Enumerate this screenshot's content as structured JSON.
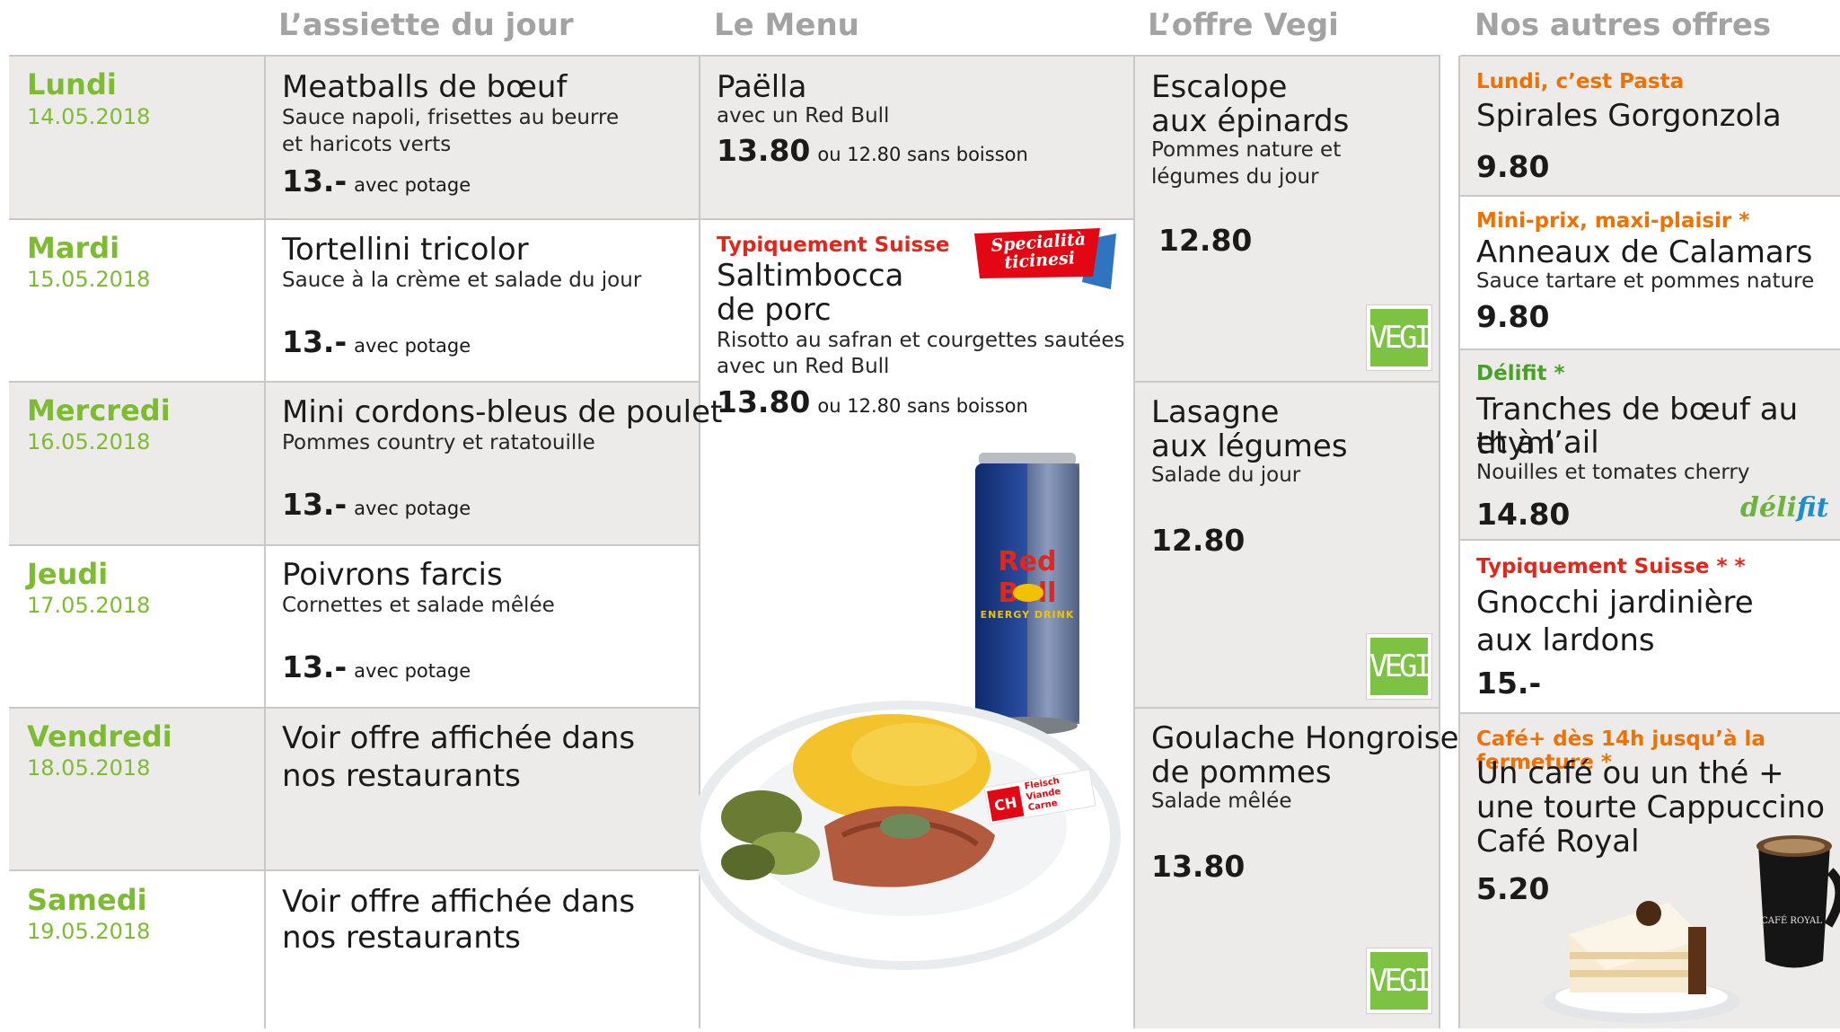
{
  "headers": {
    "assiette": "L’assiette du jour",
    "menu": "Le Menu",
    "vegi": "L’offre Vegi",
    "autres": "Nos autres offres"
  },
  "days": [
    {
      "name": "Lundi",
      "date": "14.05.2018",
      "title_lines": [
        "Meatballs de bœuf"
      ],
      "desc_lines": [
        "Sauce napoli, frisettes au beurre",
        "et haricots verts"
      ],
      "price": "13.-",
      "price_suffix": "avec potage"
    },
    {
      "name": "Mardi",
      "date": "15.05.2018",
      "title_lines": [
        "Tortellini tricolor"
      ],
      "desc_lines": [
        "Sauce à la crème et salade du jour"
      ],
      "price": "13.-",
      "price_suffix": "avec potage"
    },
    {
      "name": "Mercredi",
      "date": "16.05.2018",
      "title_lines": [
        "Mini cordons-bleus de poulet"
      ],
      "desc_lines": [
        "Pommes country et ratatouille"
      ],
      "price": "13.-",
      "price_suffix": "avec potage"
    },
    {
      "name": "Jeudi",
      "date": "17.05.2018",
      "title_lines": [
        "Poivrons farcis"
      ],
      "desc_lines": [
        "Cornettes et salade mêlée"
      ],
      "price": "13.-",
      "price_suffix": "avec potage"
    },
    {
      "name": "Vendredi",
      "date": "18.05.2018",
      "title_lines": [
        "Voir offre affichée dans",
        "nos restaurants"
      ],
      "desc_lines": [],
      "price": "",
      "price_suffix": ""
    },
    {
      "name": "Samedi",
      "date": "19.05.2018",
      "title_lines": [
        "Voir offre affichée dans",
        "nos restaurants"
      ],
      "desc_lines": [],
      "price": "",
      "price_suffix": ""
    }
  ],
  "menu": {
    "first": {
      "title": "Paëlla",
      "desc": "avec un Red Bull",
      "price": "13.80",
      "price_suffix": "ou 12.80 sans boisson"
    },
    "second": {
      "label": "Typiquement Suisse",
      "badge_line1": "Specialità",
      "badge_line2": "ticinesi",
      "title_lines": [
        "Saltimbocca",
        "de porc"
      ],
      "desc_lines": [
        "Risotto au safran et courgettes sautées",
        "avec un Red Bull"
      ],
      "price": "13.80",
      "price_suffix": "ou 12.80 sans boisson"
    },
    "can_brand": "Red Bull",
    "can_sub": "ENERGY DRINK",
    "flag_ch": "CH",
    "flag_lines": [
      "Fleisch",
      "Viande",
      "Carne"
    ]
  },
  "vegi": [
    {
      "title_lines": [
        "Escalope",
        "aux épinards"
      ],
      "desc_lines": [
        "Pommes nature et",
        "légumes du jour"
      ],
      "price": "12.80",
      "badge": "VEGI"
    },
    {
      "title_lines": [
        "Lasagne",
        "aux légumes"
      ],
      "desc_lines": [
        "Salade du jour"
      ],
      "price": "12.80",
      "badge": "VEGI"
    },
    {
      "title_lines": [
        "Goulache Hongroise",
        "de pommes"
      ],
      "desc_lines": [
        "Salade mêlée"
      ],
      "price": "13.80",
      "badge": "VEGI"
    }
  ],
  "autres": [
    {
      "label": "Lundi, c’est Pasta",
      "title_lines": [
        "Spirales Gorgonzola"
      ],
      "desc_lines": [],
      "price": "9.80"
    },
    {
      "label": "Mini-prix, maxi-plaisir *",
      "title_lines": [
        "Anneaux de Calamars"
      ],
      "desc_lines": [
        "Sauce tartare et pommes nature"
      ],
      "price": "9.80"
    },
    {
      "label": "Délifit *",
      "title_lines": [
        "Tranches de bœuf au thym",
        "et à l’ail"
      ],
      "desc_lines": [
        "Nouilles et tomates cherry"
      ],
      "price": "14.80",
      "logo_part1": "déli",
      "logo_part2": "fit"
    },
    {
      "label": "Typiquement Suisse * *",
      "title_lines": [
        "Gnocchi jardinière",
        "aux lardons"
      ],
      "desc_lines": [],
      "price": "15.-"
    },
    {
      "label": "Café+ dès 14h jusqu’à la fermeture *",
      "title_lines": [
        "Un café ou un thé +",
        "une tourte Cappuccino",
        "Café Royal"
      ],
      "desc_lines": [],
      "price": "5.20",
      "cup_text": "CAFÉ ROYAL"
    }
  ],
  "colors": {
    "day_green": "#7dbb32",
    "red_label": "#e2261c",
    "orange_label": "#ee7203",
    "green_label": "#47a224",
    "shade": "#ecebea",
    "vegi_green": "#7dc242"
  }
}
